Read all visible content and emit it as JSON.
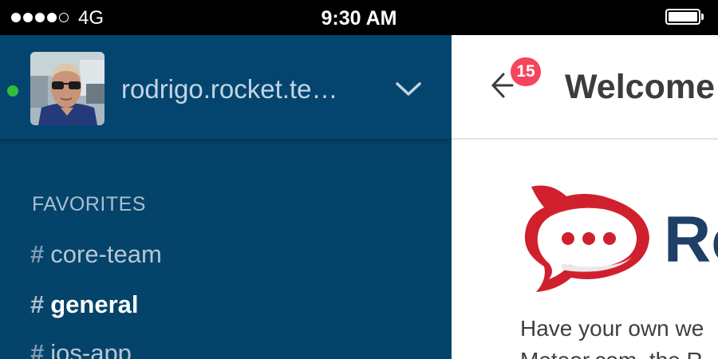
{
  "status_bar": {
    "signal_bars": 5,
    "signal_filled": 4,
    "network": "4G",
    "time": "9:30 AM",
    "battery_level": 1.0
  },
  "sidebar": {
    "user": {
      "username": "rodrigo.rocket.te…",
      "status": "online",
      "status_color": "#2fbf3a"
    },
    "section_title": "FAVORITES",
    "channels": [
      {
        "hash": "#",
        "name": "core-team",
        "active": false
      },
      {
        "hash": "#",
        "name": "general",
        "active": true
      },
      {
        "hash": "#",
        "name": "ios-app",
        "active": false
      }
    ],
    "background_color": "#04436a"
  },
  "main": {
    "badge_count": "15",
    "title": "Welcome",
    "logo_text": "Ro",
    "logo_color": "#d0202e",
    "welcome_lines": [
      "Have your own we",
      "Meteor.com, the R"
    ]
  },
  "icons": {
    "back": "arrow-left-icon",
    "chevron": "chevron-down-icon",
    "logo": "rocket-chat-logo"
  }
}
